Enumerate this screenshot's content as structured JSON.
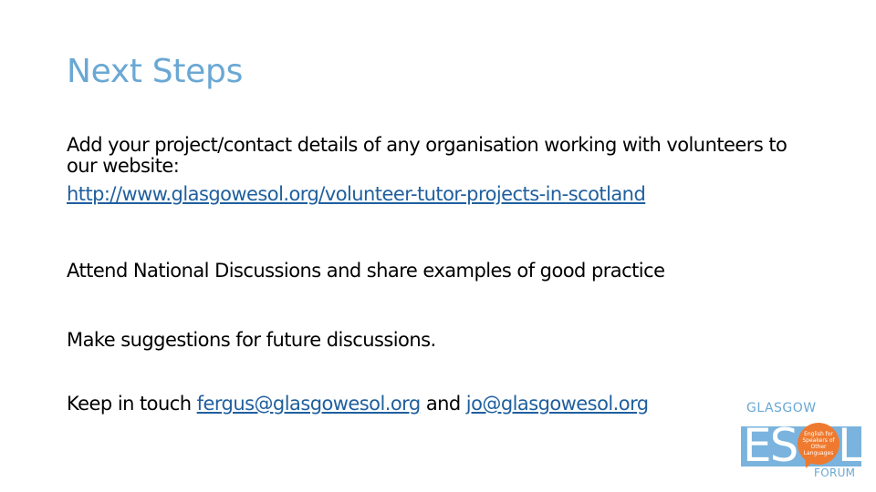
{
  "slide": {
    "title": "Next Steps",
    "paragraphs": {
      "p1_text": "Add your project/contact details of any organisation working with volunteers to our website:",
      "p1_link": "http://www.glasgowesol.org/volunteer-tutor-projects-in-scotland",
      "p2_text": "Attend National Discussions and share examples of good practice",
      "p3_text": "Make suggestions for future discussions.",
      "p4_prefix": "Keep in touch ",
      "p4_email1": "fergus@glasgowesol.org",
      "p4_and": " and ",
      "p4_email2": "jo@glasgowesol.org"
    },
    "logo": {
      "top": "GLASGOW",
      "letters_es": "ES",
      "letter_l": "L",
      "bubble": "English for Speakers of Other Languages",
      "bottom": "FORUM"
    },
    "colors": {
      "title": "#6aa8d4",
      "link": "#1f5f9e",
      "logo_blue": "#7ab3dd",
      "logo_orange": "#ef7a2f"
    }
  }
}
